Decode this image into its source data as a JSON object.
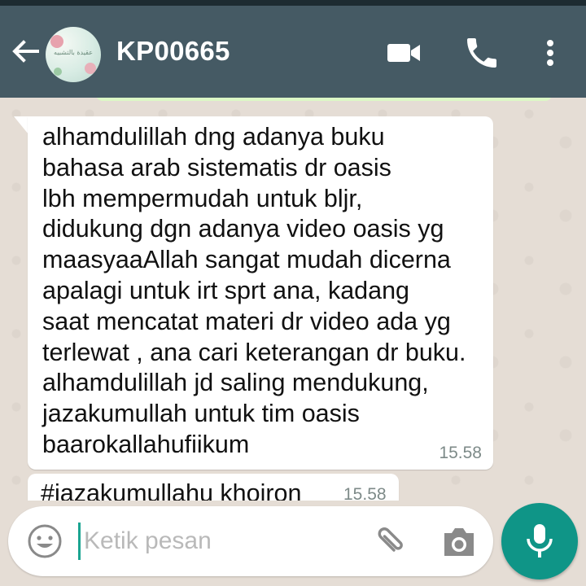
{
  "header": {
    "contact_name": "KP00665",
    "avatar_text": "عقيدة بالتشبيه",
    "icons": {
      "back": "arrow-left-icon",
      "video": "video-camera-icon",
      "call": "phone-icon",
      "menu": "more-vertical-icon"
    }
  },
  "messages": [
    {
      "text": "alhamdulillah dng adanya buku\nbahasa arab sistematis dr oasis\nlbh mempermudah untuk bljr,\ndidukung dgn adanya video oasis yg\nmaasyaaAllah sangat mudah dicerna\napalagi untuk irt sprt ana, kadang\nsaat mencatat materi dr video ada yg\nterlewat , ana cari keterangan dr buku.\nalhamdulillah jd saling mendukung,\njazakumullah untuk tim oasis\nbaarokallahufiikum",
      "time": "15.58"
    },
    {
      "text": "#jazakumullahu khoiron",
      "time": "15.58"
    }
  ],
  "composer": {
    "placeholder": "Ketik pesan",
    "icons": {
      "emoji": "emoji-icon",
      "attach": "paperclip-icon",
      "camera": "camera-icon",
      "mic": "microphone-icon"
    }
  },
  "colors": {
    "header": "#455a64",
    "accent": "#0f9587",
    "chat_bg": "#e5ddd5",
    "outgoing_bubble": "#dcf8c6",
    "incoming_bubble": "#ffffff"
  }
}
